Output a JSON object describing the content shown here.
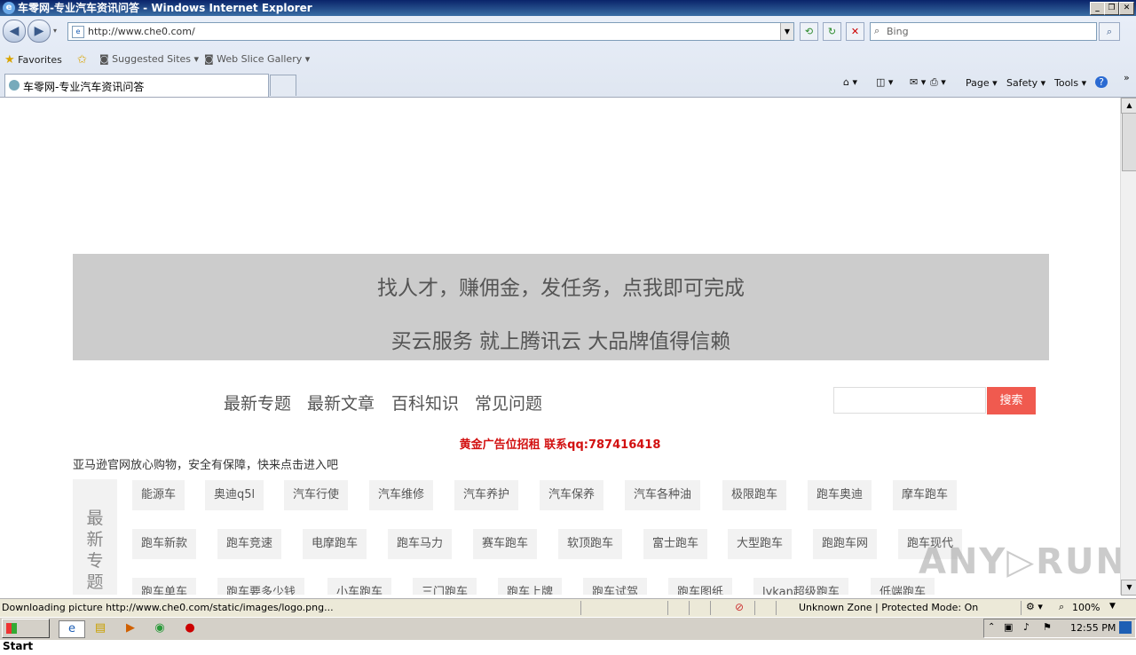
{
  "window": {
    "title": "车零网-专业汽车资讯问答 - Windows Internet Explorer",
    "min": "_",
    "max": "❐",
    "close": "✕"
  },
  "address_bar": {
    "url": "http://www.che0.com/"
  },
  "search_box": {
    "placeholder": "Bing"
  },
  "favorites_bar": {
    "favorites_label": "Favorites",
    "suggested_sites": "Suggested Sites ▾",
    "web_slice_gallery": "Web Slice Gallery ▾"
  },
  "tab": {
    "title": "车零网-专业汽车资讯问答"
  },
  "command_bar": {
    "page": "Page ▾",
    "safety": "Safety ▾",
    "tools": "Tools ▾",
    "help": "?"
  },
  "page": {
    "banner": {
      "line1": "找人才，赚佣金，发任务，点我即可完成",
      "line2": "买云服务 就上腾讯云 大品牌值得信赖"
    },
    "nav": [
      "最新专题",
      "最新文章",
      "百科知识",
      "常见问题"
    ],
    "search_button": "搜索",
    "ad_text": "黄金广告位招租 联系qq:787416418",
    "amazon_text": "亚马逊官网放心购物，安全有保障，快来点击进入吧",
    "tags_label": "最新专题",
    "tags_row1": [
      "能源车",
      "奥迪q5l",
      "汽车行使",
      "汽车维修",
      "汽车养护",
      "汽车保养",
      "汽车各种油",
      "极限跑车",
      "跑车奥迪",
      "摩车跑车"
    ],
    "tags_row2": [
      "跑车新款",
      "跑车竞速",
      "电摩跑车",
      "跑车马力",
      "赛车跑车",
      "软顶跑车",
      "富士跑车",
      "大型跑车",
      "跑跑车网",
      "跑车现代"
    ],
    "tags_row3": [
      "跑车单车",
      "跑车要多少钱",
      "小车跑车",
      "三门跑车",
      "跑车上牌",
      "跑车试驾",
      "跑车图纸",
      "lykan超级跑车",
      "低端跑车"
    ]
  },
  "watermark": "ANY▷RUN",
  "status_bar": {
    "message": "Downloading picture http://www.che0.com/static/images/logo.png...",
    "zone": "Unknown Zone | Protected Mode: On",
    "zoom": "100%"
  },
  "taskbar": {
    "start": "Start",
    "clock": "12:55 PM"
  }
}
